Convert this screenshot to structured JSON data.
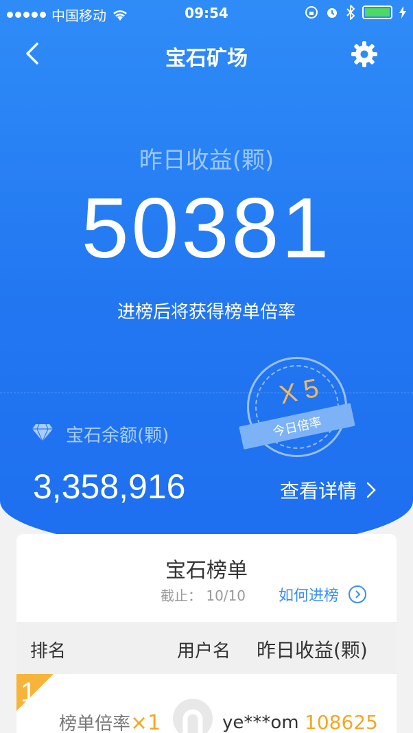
{
  "status_bar": {
    "carrier": "中国移动",
    "time": "09:54"
  },
  "nav": {
    "title": "宝石矿场",
    "back_icon": "chevron-left-icon",
    "settings_icon": "gear-icon"
  },
  "yesterday": {
    "label": "昨日收益(颗)",
    "value": "50381",
    "hint": "进榜后将获得榜单倍率"
  },
  "multiplier_seal": {
    "multiplier": "X 5",
    "caption": "今日倍率"
  },
  "balance": {
    "label": "宝石余额(颗)",
    "value": "3,358,916",
    "details_link": "查看详情"
  },
  "leaderboard": {
    "title": "宝石榜单",
    "deadline": "截止： 10/10",
    "how_link": "如何进榜",
    "columns": [
      "排名",
      "用户名",
      "昨日收益(颗)"
    ],
    "rows": [
      {
        "rank": "1",
        "multiplier_label": "榜单倍率",
        "multiplier_value": "×1",
        "username": "ye***om",
        "income": "108625"
      }
    ]
  },
  "colors": {
    "hero_blue": "#2277f1",
    "accent_orange": "#f5a623",
    "link_blue": "#3a8ef6"
  }
}
